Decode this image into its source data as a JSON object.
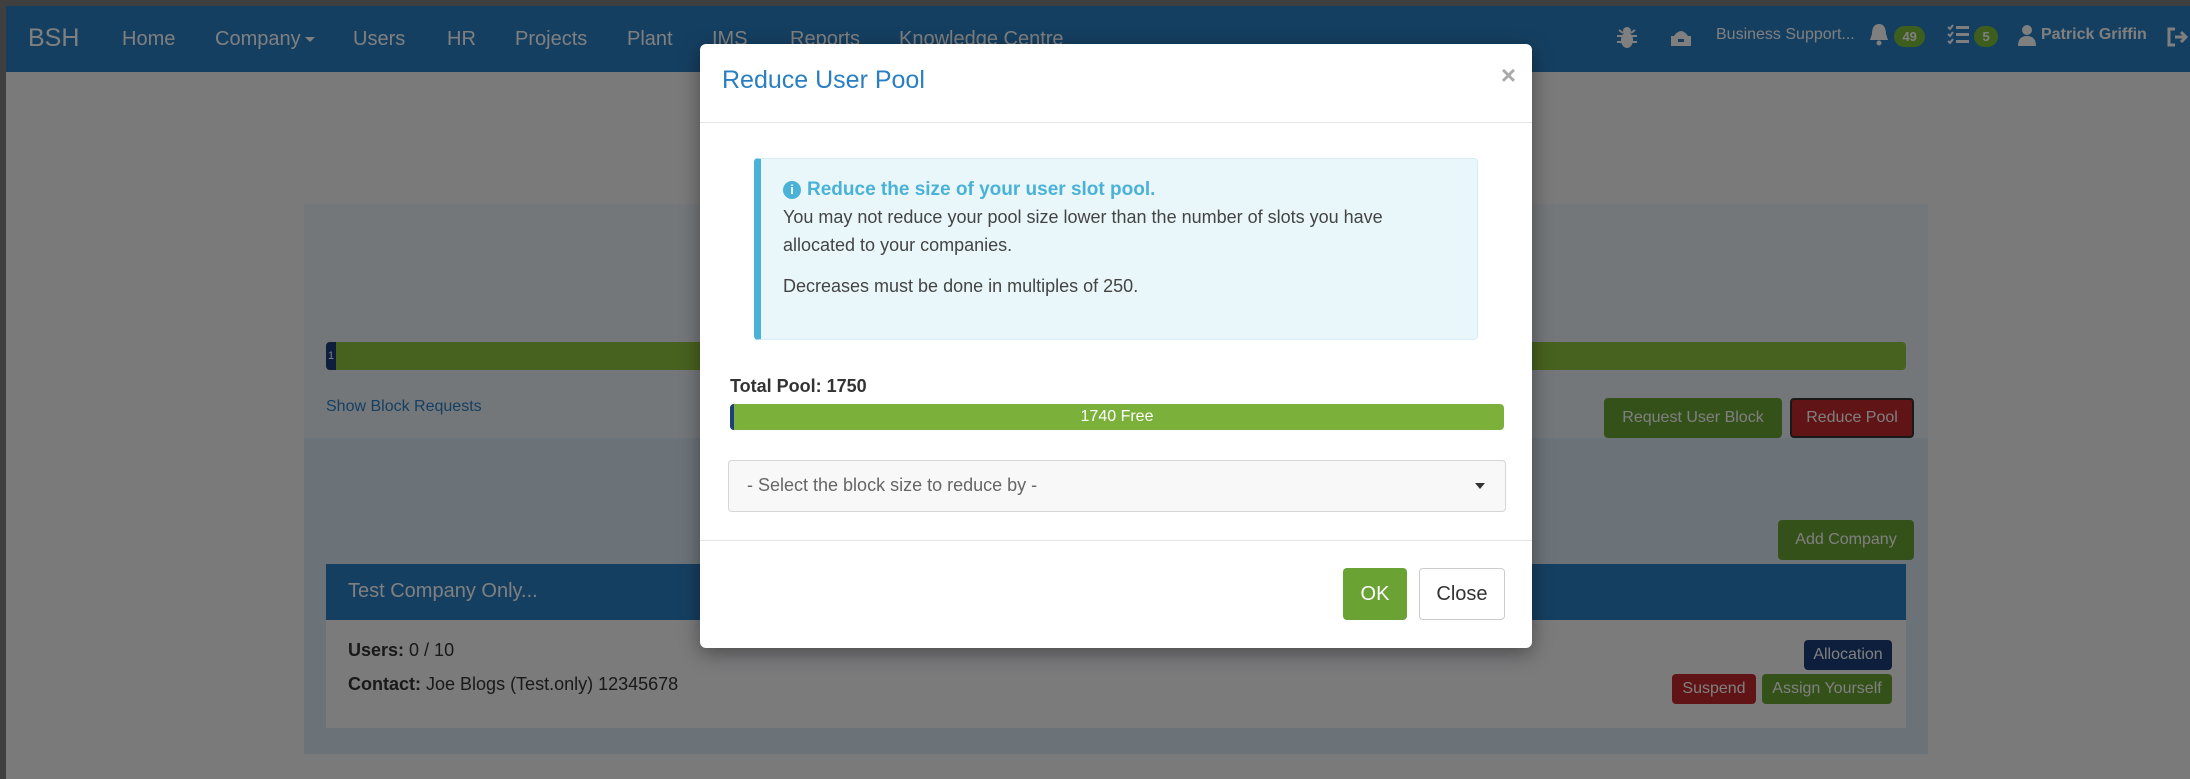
{
  "navbar": {
    "brand": "BSH",
    "items": [
      "Home",
      "Company",
      "Users",
      "HR",
      "Projects",
      "Plant",
      "IMS",
      "Reports",
      "Knowledge Centre"
    ],
    "business": "Business Support...",
    "notifications_count": "49",
    "tasks_count": "5",
    "user_name": "Patrick Griffin"
  },
  "background": {
    "progress_used_label": "1",
    "show_block_requests": "Show Block Requests",
    "request_user_block": "Request User Block",
    "reduce_pool": "Reduce Pool",
    "add_company": "Add Company",
    "company": {
      "name": "Test Company Only...",
      "users_label": "Users:",
      "users_value": "0 / 10",
      "contact_label": "Contact:",
      "contact_value": "Joe Blogs (Test.only) 12345678",
      "allocation": "Allocation",
      "suspend": "Suspend",
      "assign_yourself": "Assign Yourself"
    }
  },
  "modal": {
    "title": "Reduce User Pool",
    "close_symbol": "×",
    "info": {
      "icon": "i",
      "heading": "Reduce the size of your user slot pool.",
      "line1": "You may not reduce your pool size lower than the number of slots you have allocated to your companies.",
      "line2": "Decreases must be done in multiples of 250."
    },
    "total_pool_label": "Total Pool: 1750",
    "pool_used_fraction": 0.0057,
    "free_label": "1740 Free",
    "select_placeholder": "- Select the block size to reduce by -",
    "ok": "OK",
    "close": "Close"
  },
  "colors": {
    "primary": "#2a7fc2",
    "success": "#6aa234",
    "danger": "#c2292c",
    "info": "#4ab2d6",
    "navy": "#1d3f7a"
  }
}
